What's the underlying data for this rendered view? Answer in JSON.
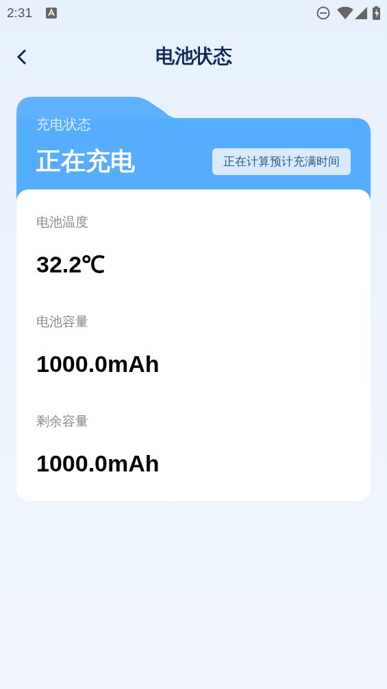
{
  "status_bar": {
    "time": "2:31"
  },
  "header": {
    "title": "电池状态"
  },
  "charging": {
    "label": "充电状态",
    "status": "正在充电",
    "estimate": "正在计算预计充满时间"
  },
  "metrics": [
    {
      "label": "电池温度",
      "value": "32.2℃"
    },
    {
      "label": "电池容量",
      "value": "1000.0mAh"
    },
    {
      "label": "剩余容量",
      "value": "1000.0mAh"
    }
  ]
}
